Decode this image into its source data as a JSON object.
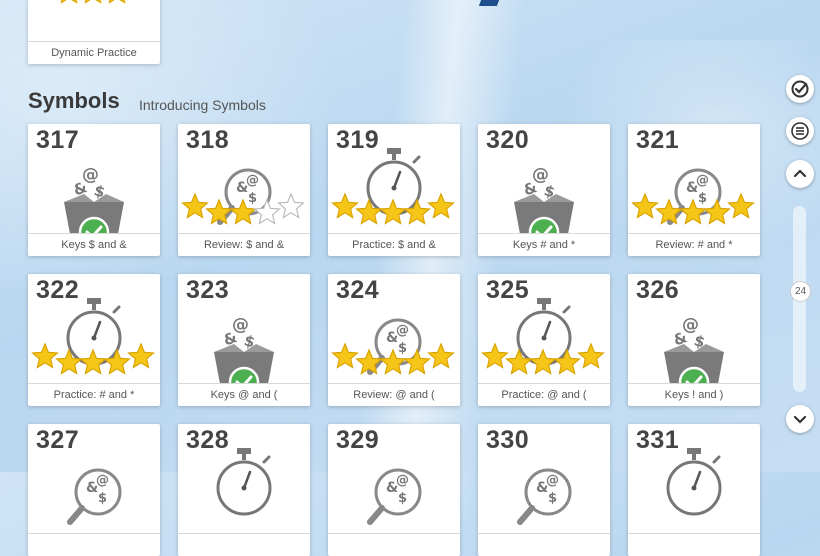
{
  "colors": {
    "accent": "#4caf50",
    "star": "#f5c518",
    "icon_gray": "#7a7a7a"
  },
  "top_card": {
    "label": "Dynamic Practice"
  },
  "section": {
    "title": "Symbols",
    "subtitle": "Introducing Symbols"
  },
  "cards": [
    {
      "number": "317",
      "label": "Keys $ and &",
      "type": "keys-box"
    },
    {
      "number": "318",
      "label": "Review: $ and &",
      "type": "review",
      "stars_filled": 3,
      "stars_total": 5
    },
    {
      "number": "319",
      "label": "Practice: $ and &",
      "type": "practice",
      "stars_filled": 5,
      "stars_total": 5
    },
    {
      "number": "320",
      "label": "Keys # and *",
      "type": "keys-box"
    },
    {
      "number": "321",
      "label": "Review: # and *",
      "type": "review",
      "stars_filled": 5,
      "stars_total": 5
    },
    {
      "number": "322",
      "label": "Practice: # and *",
      "type": "practice",
      "stars_filled": 5,
      "stars_total": 5
    },
    {
      "number": "323",
      "label": "Keys @ and (",
      "type": "keys-box"
    },
    {
      "number": "324",
      "label": "Review: @ and (",
      "type": "review",
      "stars_filled": 5,
      "stars_total": 5
    },
    {
      "number": "325",
      "label": "Practice: @ and (",
      "type": "practice",
      "stars_filled": 5,
      "stars_total": 5
    },
    {
      "number": "326",
      "label": "Keys ! and )",
      "type": "keys-box"
    },
    {
      "number": "327",
      "label": "",
      "type": "review"
    },
    {
      "number": "328",
      "label": "",
      "type": "practice"
    },
    {
      "number": "329",
      "label": "",
      "type": "review"
    },
    {
      "number": "330",
      "label": "",
      "type": "review"
    },
    {
      "number": "331",
      "label": "",
      "type": "practice"
    }
  ],
  "controls": {
    "check_icon": "check-circle-icon",
    "menu_icon": "menu-icon",
    "up_icon": "chevron-up-icon",
    "down_icon": "chevron-down-icon",
    "scroll_value": "24"
  }
}
